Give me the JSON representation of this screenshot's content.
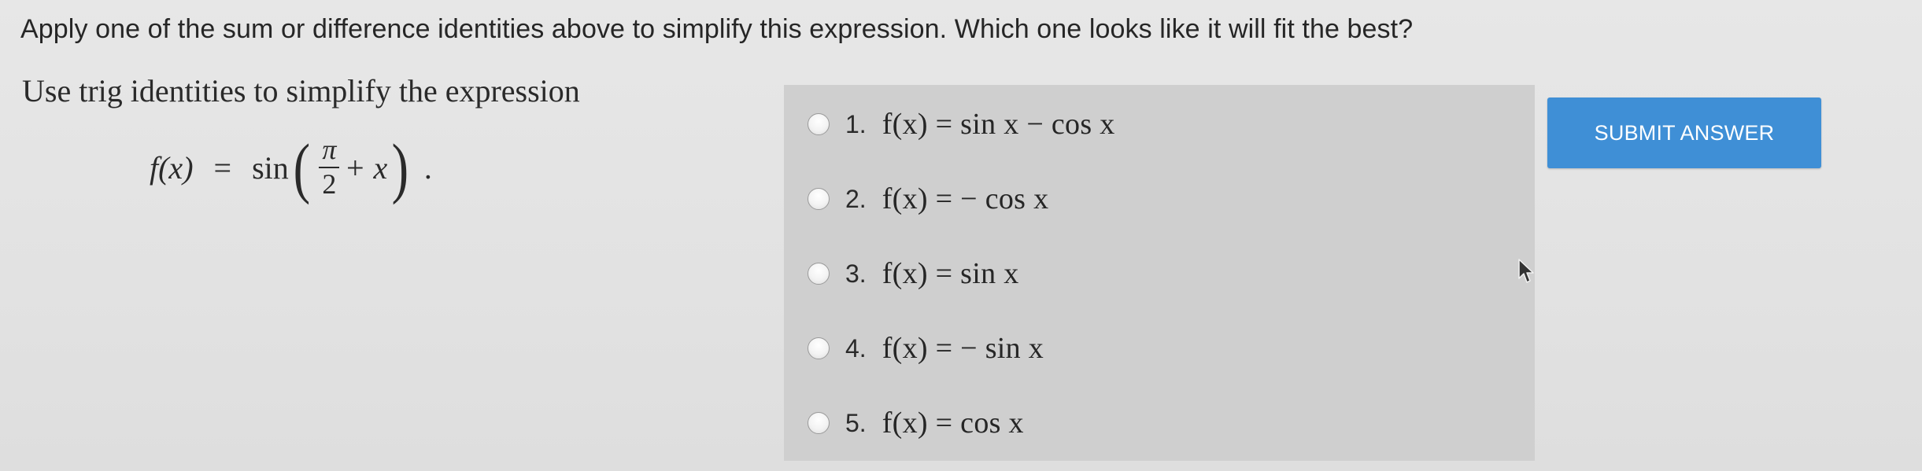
{
  "instruction": "Apply one of the sum or difference identities above to simplify this expression. Which one looks like it will fit the best?",
  "problem": {
    "heading": "Use trig identities to simplify the expression",
    "lhs": "f(x)",
    "equals": "=",
    "func": "sin",
    "frac_numerator": "π",
    "frac_denominator": "2",
    "plus_term": "+ x",
    "trailing": "."
  },
  "choices": [
    {
      "number": "1.",
      "expression": "f(x)  =  sin x − cos x"
    },
    {
      "number": "2.",
      "expression": "f(x)  =  − cos x"
    },
    {
      "number": "3.",
      "expression": "f(x)  =  sin x"
    },
    {
      "number": "4.",
      "expression": "f(x)  =  − sin x"
    },
    {
      "number": "5.",
      "expression": "f(x)  =  cos x"
    }
  ],
  "submit": {
    "label": "SUBMIT ANSWER",
    "color": "#3f8fd6"
  },
  "icons": {
    "cursor": "mouse-pointer-icon",
    "radio": "radio-button-icon"
  }
}
